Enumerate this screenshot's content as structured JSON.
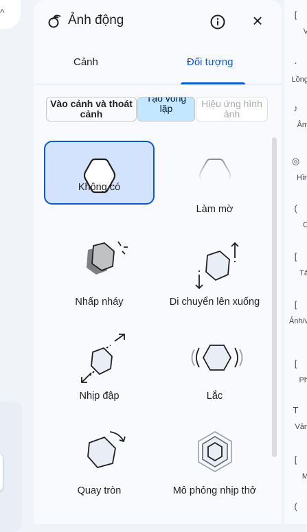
{
  "panel": {
    "title": "Ảnh động",
    "close_symbol": "×"
  },
  "tabs": [
    {
      "label": "Cảnh",
      "active": false
    },
    {
      "label": "Đối tượng",
      "active": true
    }
  ],
  "segments": [
    {
      "label": "Vào cảnh và thoát cảnh",
      "state": "default"
    },
    {
      "label": "Tạo vòng lặp",
      "state": "selected"
    },
    {
      "label": "Hiệu ứng hình ảnh",
      "state": "disabled"
    }
  ],
  "effects": [
    {
      "label": "Không có",
      "icon": "hexagon-outline-icon",
      "selected": true
    },
    {
      "label": "Làm mờ",
      "icon": "hexagon-blur-icon",
      "selected": false
    },
    {
      "label": "Nhấp nháy",
      "icon": "hexagon-flicker-icon",
      "selected": false
    },
    {
      "label": "Di chuyển lên xuống",
      "icon": "hexagon-up-down-icon",
      "selected": false
    },
    {
      "label": "Nhịp đập",
      "icon": "hexagon-pulse-icon",
      "selected": false
    },
    {
      "label": "Lắc",
      "icon": "hexagon-wiggle-icon",
      "selected": false
    },
    {
      "label": "Quay tròn",
      "icon": "hexagon-rotate-icon",
      "selected": false
    },
    {
      "label": "Mô phỏng nhịp thở",
      "icon": "hexagon-breathe-icon",
      "selected": false
    }
  ],
  "right_rail": [
    {
      "icon_text": "[",
      "label": "V"
    },
    {
      "icon_text": "·",
      "label": "Lồng"
    },
    {
      "icon_text": "♪",
      "label": "Âm"
    },
    {
      "icon_text": "◎",
      "label": "Hìn"
    },
    {
      "icon_text": "(",
      "label": "C"
    },
    {
      "icon_text": "[",
      "label": "Tả"
    },
    {
      "icon_text": "[",
      "label": "Ảnh/v"
    },
    {
      "icon_text": "[",
      "label": "Ph"
    },
    {
      "icon_text": "T",
      "label": "Văn"
    },
    {
      "icon_text": "[",
      "label": "M"
    },
    {
      "icon_text": "(",
      "label": ""
    }
  ],
  "colors": {
    "accent": "#0b57d0",
    "selected_tile_bg": "#d3e3fd",
    "selected_segment_bg": "#c2e7ff"
  }
}
